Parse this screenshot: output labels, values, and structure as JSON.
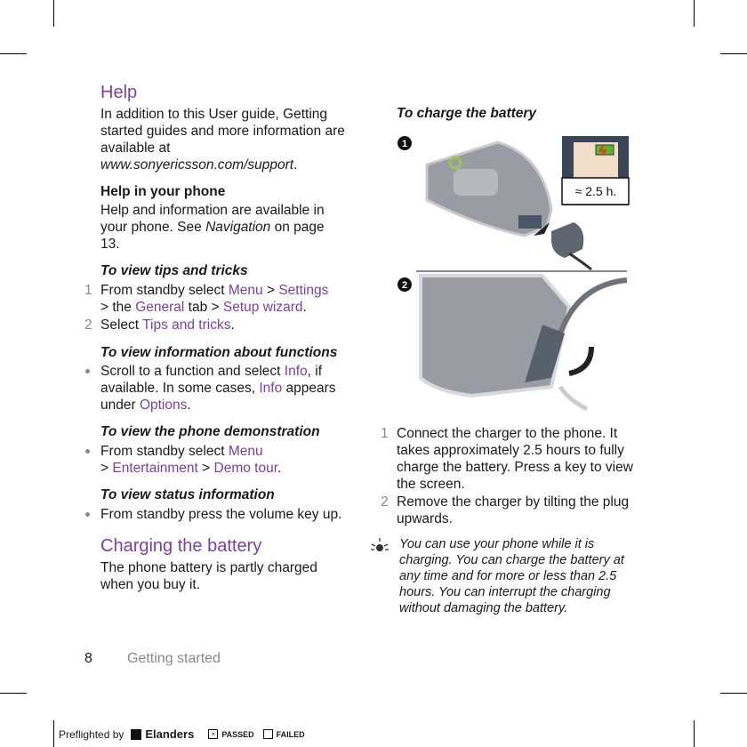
{
  "help": {
    "title": "Help",
    "intro": "In addition to this User guide, Getting started guides and more information are available at",
    "url": "www.sonyericsson.com/support",
    "url_end": ".",
    "phone_title": "Help in your phone",
    "phone_text_a": "Help and information are available in your phone. See ",
    "phone_text_link": "Navigation",
    "phone_text_b": " on page 13."
  },
  "tips": {
    "title": "To view tips and tricks",
    "steps": [
      {
        "n": "1",
        "a": "From standby select ",
        "l1": "Menu",
        "b": " > ",
        "l2": "Settings",
        "c": " > the ",
        "l3": "General",
        "d": " tab > ",
        "l4": "Setup wizard",
        "e": "."
      },
      {
        "n": "2",
        "a": "Select ",
        "l1": "Tips and tricks",
        "b": "."
      }
    ]
  },
  "functions": {
    "title": "To view information about functions",
    "a": "Scroll to a function and select ",
    "l1": "Info",
    "b": ", if available. In some cases, ",
    "l2": "Info",
    "c": " appears under ",
    "l3": "Options",
    "d": "."
  },
  "demo": {
    "title": "To view the phone demonstration",
    "a": "From standby select ",
    "l1": "Menu",
    "b": " > ",
    "l2": "Entertainment",
    "c": " > ",
    "l3": "Demo tour",
    "d": "."
  },
  "status": {
    "title": "To view status information",
    "text": "From standby press the volume key up."
  },
  "charging": {
    "title": "Charging the battery",
    "text": "The phone battery is partly charged when you buy it."
  },
  "charge": {
    "title": "To charge the battery",
    "fig_label": "≈ 2.5 h.",
    "steps": [
      {
        "n": "1",
        "text": "Connect the charger to the phone. It takes approximately 2.5 hours to fully charge the battery. Press a key to view the screen."
      },
      {
        "n": "2",
        "text": "Remove the charger by tilting the plug upwards."
      }
    ],
    "note": "You can use your phone while it is charging. You can charge the battery at any time and for more or less than 2.5 hours. You can interrupt the charging without damaging the battery."
  },
  "footer": {
    "page": "8",
    "section": "Getting started"
  },
  "preflight": {
    "by": "Preflighted by",
    "brand": "Elanders",
    "passed": "PASSED",
    "failed": "FAILED"
  },
  "colors": {
    "accent": "#7b3f9e"
  }
}
